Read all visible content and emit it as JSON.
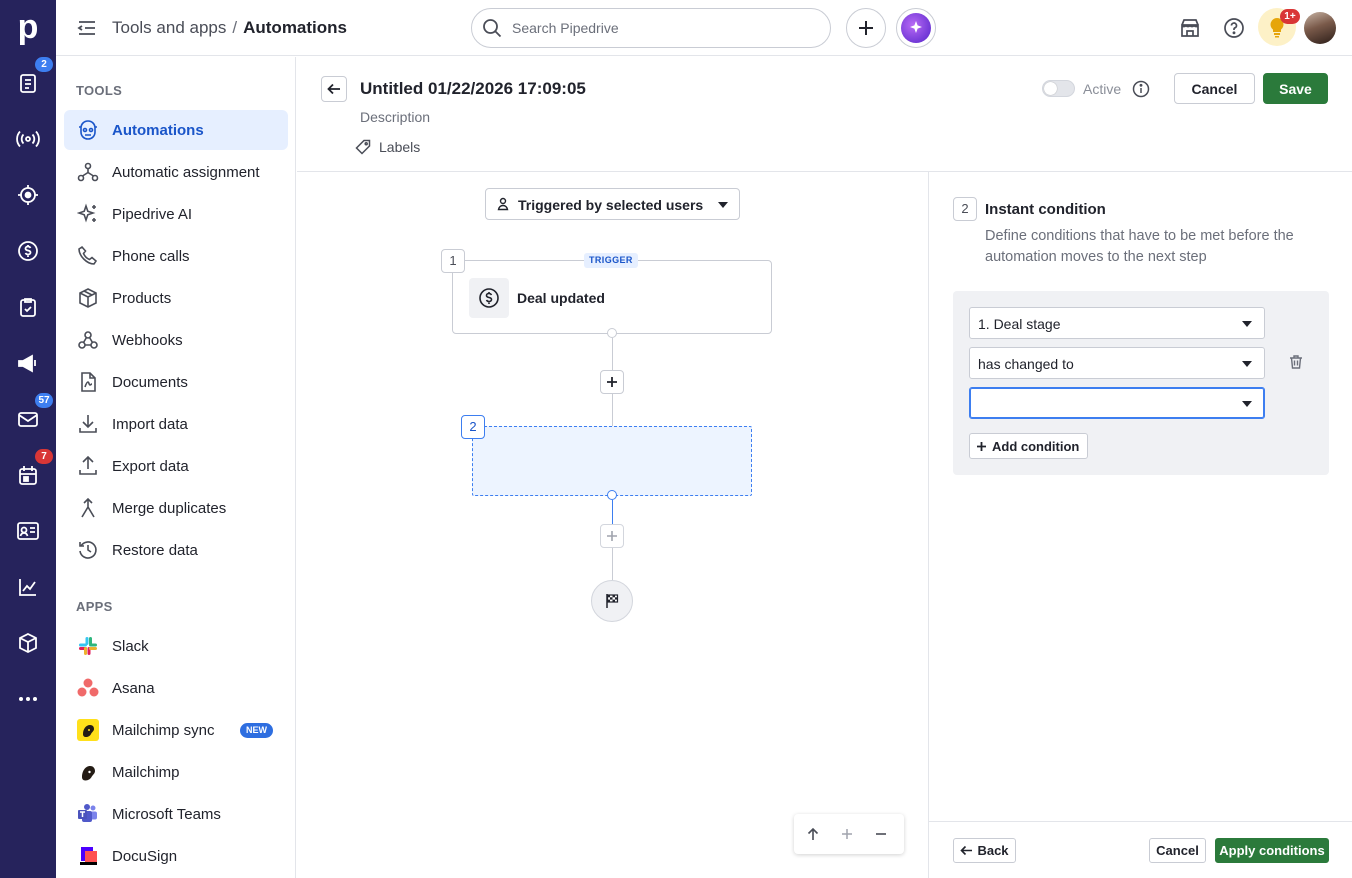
{
  "rail": {
    "badges": {
      "activities": "2",
      "mail": "57",
      "calendar": "7"
    }
  },
  "topbar": {
    "breadcrumb_parent": "Tools and apps",
    "breadcrumb_separator": "/",
    "breadcrumb_current": "Automations",
    "search_placeholder": "Search Pipedrive",
    "tips_badge": "1+"
  },
  "sidebar": {
    "tools_title": "TOOLS",
    "tools": [
      {
        "label": "Automations",
        "icon": "automations-icon",
        "active": true
      },
      {
        "label": "Automatic assignment",
        "icon": "assignment-icon"
      },
      {
        "label": "Pipedrive AI",
        "icon": "sparkle-icon"
      },
      {
        "label": "Phone calls",
        "icon": "phone-icon"
      },
      {
        "label": "Products",
        "icon": "box-icon"
      },
      {
        "label": "Webhooks",
        "icon": "webhook-icon"
      },
      {
        "label": "Documents",
        "icon": "document-icon"
      },
      {
        "label": "Import data",
        "icon": "import-icon"
      },
      {
        "label": "Export data",
        "icon": "export-icon"
      },
      {
        "label": "Merge duplicates",
        "icon": "merge-icon"
      },
      {
        "label": "Restore data",
        "icon": "restore-icon"
      }
    ],
    "apps_title": "APPS",
    "apps": [
      {
        "label": "Slack",
        "icon": "slack-icon"
      },
      {
        "label": "Asana",
        "icon": "asana-icon"
      },
      {
        "label": "Mailchimp sync",
        "icon": "mailchimp-icon",
        "badge": "NEW"
      },
      {
        "label": "Mailchimp",
        "icon": "mailchimp-icon"
      },
      {
        "label": "Microsoft Teams",
        "icon": "teams-icon"
      },
      {
        "label": "DocuSign",
        "icon": "docusign-icon"
      }
    ]
  },
  "header": {
    "title": "Untitled 01/22/2026 17:09:05",
    "description": "Description",
    "labels": "Labels",
    "active_label": "Active",
    "cancel": "Cancel",
    "save": "Save"
  },
  "canvas": {
    "trigger_selector": "Triggered by selected users",
    "step1_number": "1",
    "trigger_tag": "TRIGGER",
    "step1_label": "Deal updated",
    "step2_number": "2"
  },
  "panel": {
    "step_number": "2",
    "title": "Instant condition",
    "description": "Define conditions that have to be met before the automation moves to the next step",
    "field": "1. Deal stage",
    "operator": "has changed to",
    "value": "",
    "add_condition": "Add condition",
    "back": "Back",
    "cancel": "Cancel",
    "apply": "Apply conditions"
  },
  "colors": {
    "rail": "#26235c",
    "accent": "#1a55c9",
    "save_green": "#2b7a3b",
    "active_bg": "#e6efff"
  }
}
